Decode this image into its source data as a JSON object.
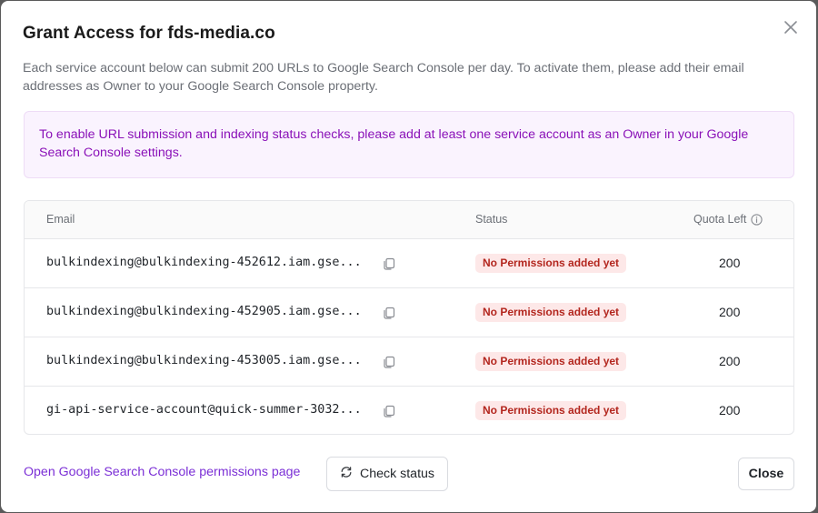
{
  "dialog": {
    "title": "Grant Access for fds-media.co",
    "description": "Each service account below can submit 200 URLs to Google Search Console per day. To activate them, please add their email addresses as Owner to your Google Search Console property.",
    "alert": "To enable URL submission and indexing status checks, please add at least one service account as an Owner in your Google Search Console settings."
  },
  "table": {
    "headers": {
      "email": "Email",
      "status": "Status",
      "quota": "Quota Left"
    },
    "rows": [
      {
        "email": "bulkindexing@bulkindexing-452612.iam.gse...",
        "status": "No Permissions added yet",
        "quota": "200"
      },
      {
        "email": "bulkindexing@bulkindexing-452905.iam.gse...",
        "status": "No Permissions added yet",
        "quota": "200"
      },
      {
        "email": "bulkindexing@bulkindexing-453005.iam.gse...",
        "status": "No Permissions added yet",
        "quota": "200"
      },
      {
        "email": "gi-api-service-account@quick-summer-3032...",
        "status": "No Permissions added yet",
        "quota": "200"
      }
    ]
  },
  "footer": {
    "link": "Open Google Search Console permissions page",
    "check_status": "Check status",
    "close": "Close"
  },
  "icons": {
    "close": "close-icon",
    "info": "info-icon",
    "copy": "copy-icon",
    "refresh": "refresh-icon"
  },
  "colors": {
    "accent": "#7b2fd6",
    "alert_text": "#8a11b8",
    "alert_bg": "#faf3fe",
    "badge_bg": "#fde8e8",
    "badge_text": "#b3261e"
  }
}
